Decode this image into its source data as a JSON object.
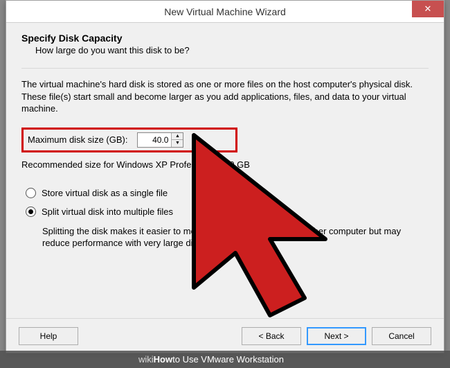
{
  "window": {
    "title": "New Virtual Machine Wizard"
  },
  "page": {
    "heading": "Specify Disk Capacity",
    "subheading": "How large do you want this disk to be?",
    "description": "The virtual machine's hard disk is stored as one or more files on the host computer's physical disk. These file(s) start small and become larger as you add applications, files, and data to your virtual machine.",
    "disk_label": "Maximum disk size (GB):",
    "disk_value": "40.0",
    "recommended": "Recommended size for Windows XP Professional: 40 GB",
    "radio_single": "Store virtual disk as a single file",
    "radio_split": "Split virtual disk into multiple files",
    "split_desc": "Splitting the disk makes it easier to move the virtual machine to another computer but may reduce performance with very large disks."
  },
  "buttons": {
    "help": "Help",
    "back": "< Back",
    "next": "Next >",
    "cancel": "Cancel"
  },
  "watermark": {
    "brand_a": "wiki",
    "brand_b": "How",
    "caption": " to Use VMware Workstation"
  }
}
